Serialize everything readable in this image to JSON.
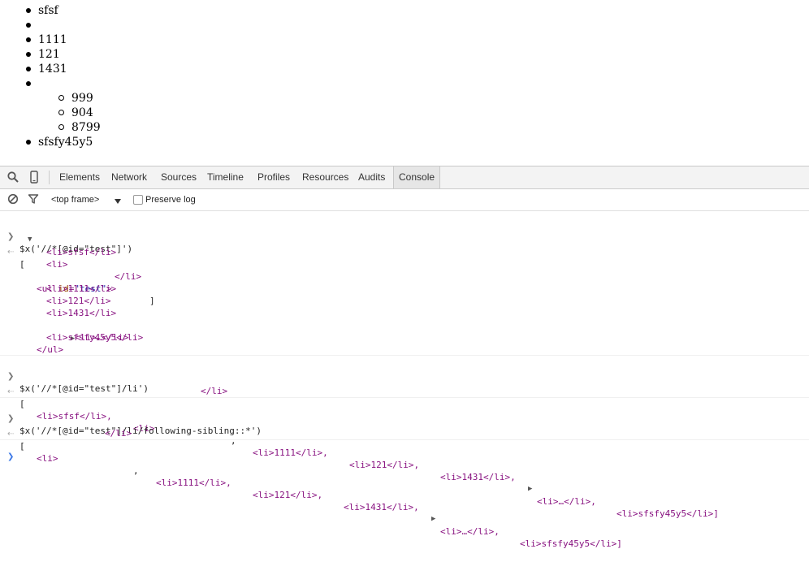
{
  "page": {
    "list_items": [
      "sfsf",
      "",
      "1111",
      "121",
      "1431",
      "",
      "sfsfy45y5"
    ],
    "nested_items": [
      "999",
      "904",
      "8799"
    ]
  },
  "devtools": {
    "tabs": [
      "Elements",
      "Network",
      "Sources",
      "Timeline",
      "Profiles",
      "Resources",
      "Audits",
      "Console"
    ],
    "active_tab": "Console",
    "frame_select": "<top frame>",
    "preserve_log_label": "Preserve log",
    "icons": [
      "search-icon",
      "device-mode-icon",
      "clear-console-icon",
      "filter-icon",
      "dropdown-arrow-icon"
    ]
  },
  "console": {
    "cmd1": "$x('//*[@id=\"test\"]')",
    "cmd2": "$x('//*[@id=\"test\"]/li')",
    "cmd3": "$x('//*[@id=\"test\"]/li/following-sibling::*')",
    "r1": {
      "open_bracket": "[",
      "close_bracket": "]",
      "ul_open_tag": "<ul",
      "id_attr": "id",
      "id_value": "\"test\"",
      "gt": ">",
      "lines": [
        "<li>sfsf</li>",
        "<li>",
        "</li>",
        "<li>1111</li>",
        "<li>121</li>",
        "<li>1431</li>",
        "<li>…</li>",
        "<li>sfsfy45y5</li>",
        "</ul>"
      ]
    },
    "r2": {
      "open_bracket": "[",
      "items": [
        "<li>sfsf</li>,",
        "<li>",
        ",",
        "<li>1111</li>,",
        "<li>121</li>,",
        "<li>1431</li>,",
        "<li>…</li>,",
        "<li>sfsfy45y5</li>]"
      ],
      "cont": "</li>"
    },
    "r3": {
      "open_bracket": "[",
      "items": [
        "<li>",
        ",",
        "<li>1111</li>,",
        "<li>121</li>,",
        "<li>1431</li>,",
        "<li>…</li>,",
        "<li>sfsfy45y5</li>]"
      ],
      "cont": "</li>"
    }
  }
}
